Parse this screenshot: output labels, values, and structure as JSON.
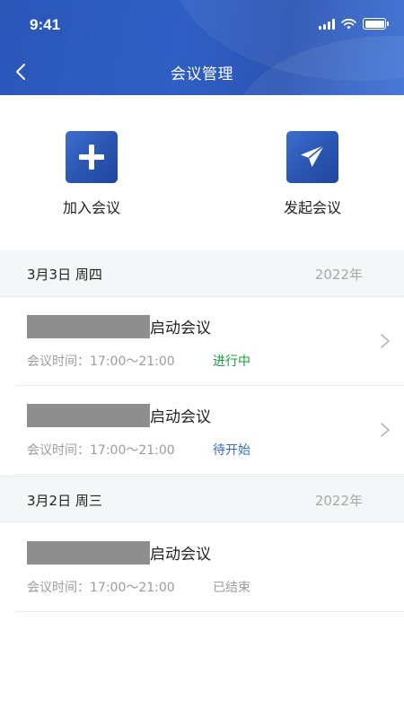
{
  "status_bar": {
    "time": "9:41"
  },
  "header": {
    "title": "会议管理"
  },
  "actions": {
    "join_label": "加入会议",
    "start_label": "发起会议"
  },
  "groups": [
    {
      "date": "3月3日 周四",
      "year": "2022年",
      "items": [
        {
          "title": "启动会议",
          "time_label": "会议时间：17:00～21:00",
          "status": "进行中",
          "status_color": "#1aa03a"
        },
        {
          "title": "启动会议",
          "time_label": "会议时间：17:00～21:00",
          "status": "待开始",
          "status_color": "#2f6fd0"
        }
      ]
    },
    {
      "date": "3月2日 周三",
      "year": "2022年",
      "items": [
        {
          "title": "启动会议",
          "time_label": "会议时间：17:00～21:00",
          "status": "已结束",
          "status_color": "#9c9c9c"
        }
      ]
    }
  ],
  "colors": {
    "brand": "#2a56b8",
    "ongoing": "#1aa03a",
    "upcoming": "#2f6fd0",
    "ended": "#9c9c9c"
  }
}
